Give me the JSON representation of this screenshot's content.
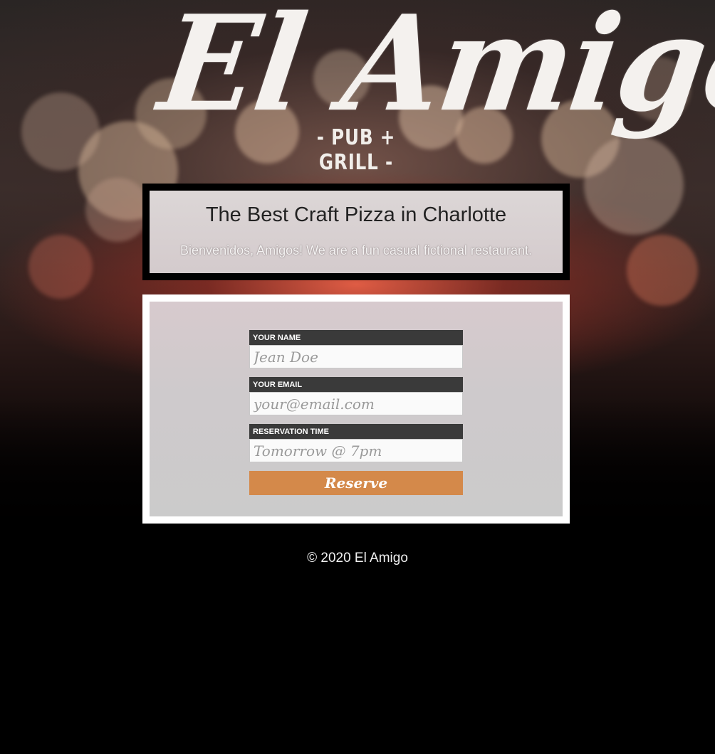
{
  "logo": {
    "main": "El Amigo",
    "sub": "- PUB + GRILL -"
  },
  "hero": {
    "title": "The Best Craft Pizza in Charlotte",
    "subtitle": "Bienvenidos, Amigos! We are a fun casual fictional restaurant."
  },
  "form": {
    "name": {
      "label": "YOUR NAME",
      "placeholder": "Jean Doe"
    },
    "email": {
      "label": "YOUR EMAIL",
      "placeholder": "your@email.com"
    },
    "time": {
      "label": "RESERVATION TIME",
      "placeholder": "Tomorrow @ 7pm"
    },
    "submit_label": "Reserve"
  },
  "footer": {
    "copyright": "© 2020 El Amigo"
  },
  "colors": {
    "button": "#d4894a",
    "label_bar": "#3a3a3a",
    "background": "#000000"
  }
}
